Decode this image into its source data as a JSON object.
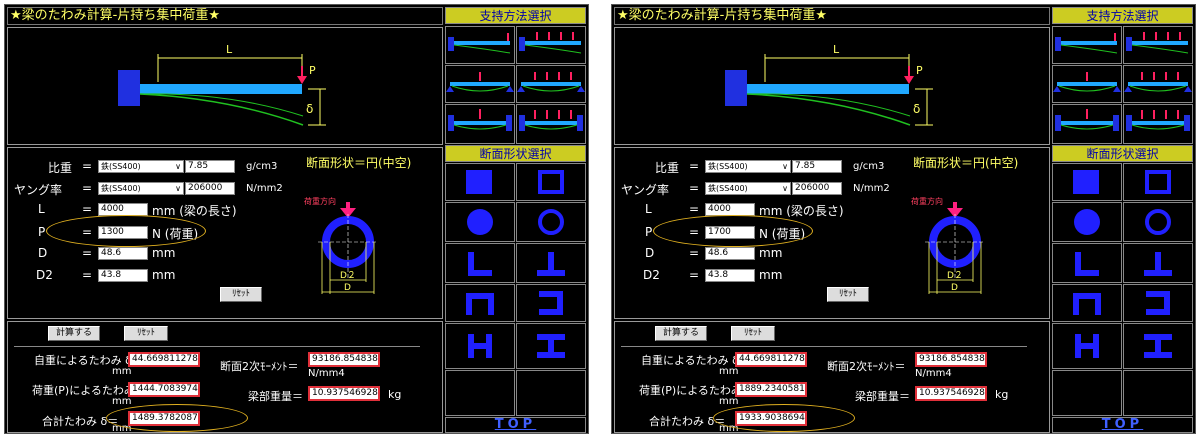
{
  "shots": [
    {
      "title": "★梁のたわみ計算-片持ち集中荷重★",
      "load": "1300",
      "res_p": "1444.708397437",
      "res_total": "1489.378208715"
    },
    {
      "title": "★梁のたわみ計算-片持ち集中荷重★",
      "load": "1700",
      "res_p": "1889.234058187",
      "res_total": "1933.903869465"
    }
  ],
  "common": {
    "support_header": "支持方法選択",
    "section_header": "断面形状選択",
    "beam": {
      "L": "L",
      "P": "P",
      "delta": "δ"
    },
    "rows": {
      "density_label": "比重",
      "eq": "=",
      "density_material": "鉄(SS400)",
      "density_value": "7.85",
      "density_unit": "g/cm3",
      "young_label": "ヤング率",
      "young_material": "鉄(SS400)",
      "young_value": "206000",
      "young_unit": "N/mm2",
      "L_label": "L",
      "L_value": "4000",
      "L_unit": "mm (梁の長さ)",
      "P_label": "P",
      "P_unit": "N (荷重)",
      "D_label": "D",
      "D_value": "48.6",
      "D_unit": "mm",
      "D2_label": "D2",
      "D2_value": "43.8",
      "D2_unit": "mm"
    },
    "section_shape": "断面形状＝円(中空)",
    "load_direction": "荷重方向",
    "dim_D2": "D２",
    "dim_D": "D",
    "reset": "ﾘｾｯﾄ",
    "calc": "計算する",
    "results": {
      "self_label": "自重によるたわみ δ＝",
      "self_value": "44.669811278",
      "unit_mm": "mm",
      "p_label": "荷重(P)によるたわみ δ＝",
      "total_label": "合計たわみ δ＝",
      "moment_label": "断面2次ﾓｰﾒﾝﾄ＝",
      "moment_value": "93186.85483800(",
      "moment_unit": "N/mm4",
      "weight_label": "梁部重量＝",
      "weight_value": "10.93754692800(",
      "weight_unit": "kg"
    },
    "top": "TOP"
  }
}
